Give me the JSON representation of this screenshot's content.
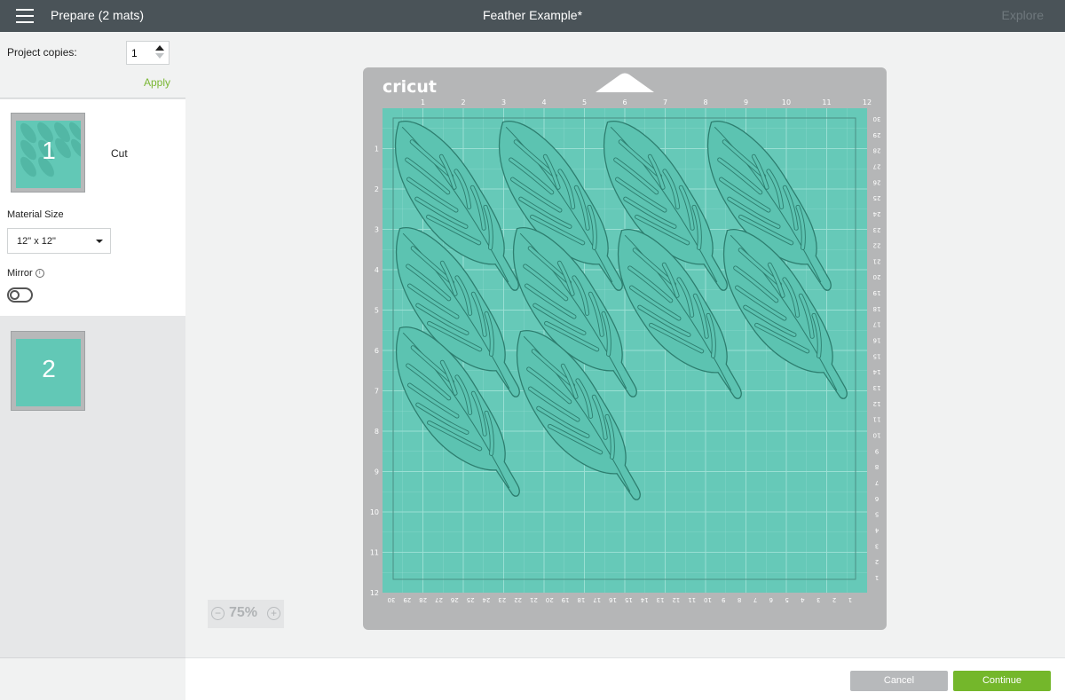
{
  "header": {
    "prepare_title": "Prepare (2 mats)",
    "document_title": "Feather Example*",
    "explore_label": "Explore",
    "menu_icon": "hamburger-menu-icon"
  },
  "sidebar": {
    "copies_label": "Project copies:",
    "copies_value": "1",
    "apply_label": "Apply",
    "mats": [
      {
        "number": "1",
        "label": "Cut"
      },
      {
        "number": "2",
        "label": ""
      }
    ],
    "material_size_label": "Material Size",
    "material_size_value": "12\" x 12\"",
    "mirror_label": "Mirror",
    "mirror_info_icon": "info-icon",
    "mirror_on": false
  },
  "mat": {
    "brand": "cricut",
    "top_ruler": [
      "1",
      "2",
      "3",
      "4",
      "5",
      "6",
      "7",
      "8",
      "9",
      "10",
      "11",
      "12"
    ],
    "left_ruler": [
      "1",
      "2",
      "3",
      "4",
      "5",
      "6",
      "7",
      "8",
      "9",
      "10",
      "11",
      "12"
    ],
    "bottom_ruler": [
      "30",
      "29",
      "28",
      "27",
      "26",
      "25",
      "24",
      "23",
      "22",
      "21",
      "20",
      "19",
      "18",
      "17",
      "16",
      "15",
      "14",
      "13",
      "12",
      "11",
      "10",
      "9",
      "8",
      "7",
      "6",
      "5",
      "4",
      "3",
      "2",
      "1"
    ],
    "right_ruler": [
      "30",
      "29",
      "28",
      "27",
      "26",
      "25",
      "24",
      "23",
      "22",
      "21",
      "20",
      "19",
      "18",
      "17",
      "16",
      "15",
      "14",
      "13",
      "12",
      "11",
      "10",
      "9",
      "8",
      "7",
      "6",
      "5",
      "4",
      "3",
      "2",
      "1"
    ],
    "colors": {
      "mat_frame": "#b5b6b7",
      "mat_surface": "#66c9b8",
      "grid_line": "#9fe2d6",
      "feather_fill": "#5cc3b1",
      "feather_stroke": "#2d7e6f"
    }
  },
  "zoom": {
    "value": "75%",
    "minus": "−",
    "plus": "+"
  },
  "footer": {
    "cancel_label": "Cancel",
    "continue_label": "Continue"
  }
}
